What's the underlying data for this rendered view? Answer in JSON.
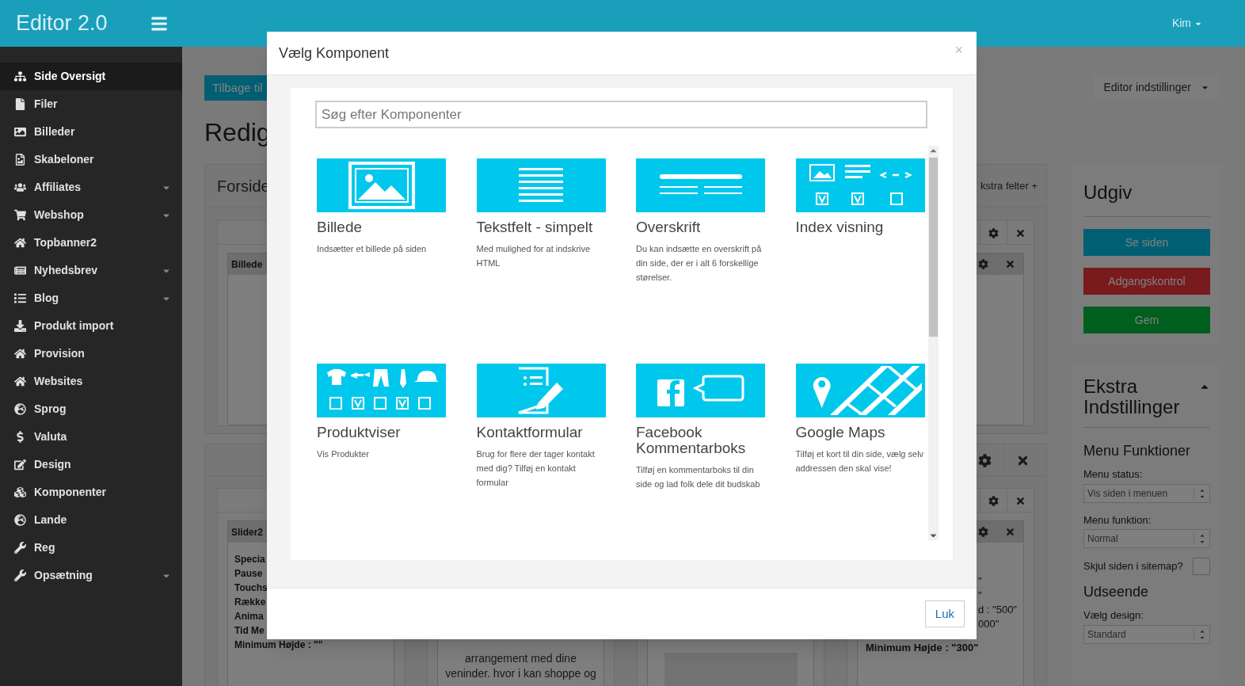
{
  "top_bar": {
    "title": "Editor 2.0",
    "user": "Kim"
  },
  "sidebar": {
    "items": [
      {
        "label": "Side Oversigt",
        "selected": true,
        "has_submenu": false
      },
      {
        "label": "Filer",
        "selected": false,
        "has_submenu": false
      },
      {
        "label": "Billeder",
        "selected": false,
        "has_submenu": false
      },
      {
        "label": "Skabeloner",
        "selected": false,
        "has_submenu": false
      },
      {
        "label": "Affiliates",
        "selected": false,
        "has_submenu": true
      },
      {
        "label": "Webshop",
        "selected": false,
        "has_submenu": true
      },
      {
        "label": "Topbanner2",
        "selected": false,
        "has_submenu": false
      },
      {
        "label": "Nyhedsbrev",
        "selected": false,
        "has_submenu": true
      },
      {
        "label": "Blog",
        "selected": false,
        "has_submenu": true
      },
      {
        "label": "Produkt import",
        "selected": false,
        "has_submenu": false
      },
      {
        "label": "Provision",
        "selected": false,
        "has_submenu": false
      },
      {
        "label": "Websites",
        "selected": false,
        "has_submenu": false
      },
      {
        "label": "Sprog",
        "selected": false,
        "has_submenu": false
      },
      {
        "label": "Valuta",
        "selected": false,
        "has_submenu": false
      },
      {
        "label": "Design",
        "selected": false,
        "has_submenu": false
      },
      {
        "label": "Komponenter",
        "selected": false,
        "has_submenu": false
      },
      {
        "label": "Lande",
        "selected": false,
        "has_submenu": false
      },
      {
        "label": "Reg",
        "selected": false,
        "has_submenu": false
      },
      {
        "label": "Opsætning",
        "selected": false,
        "has_submenu": true
      }
    ]
  },
  "page": {
    "back_button": "Tilbage til",
    "heading": "Redig",
    "settings_button": "Editor indstillinger",
    "top_card": {
      "title": "Forside",
      "extra_link": "kstra felter +",
      "box_title": "Billede"
    },
    "slider_card": {
      "box_title": "Slider2",
      "left_settings": [
        "Specia",
        "Pause",
        "Touchs",
        "Række",
        "Anima",
        "Tid Me",
        "Minimum Højde : \"\""
      ],
      "right_settings": [
        "\"",
        "\"",
        "d : \"500\"",
        "000\""
      ],
      "right_footer": "Minimum Højde : \"300\"",
      "text_lines": [
        "arrangement med dine",
        "veninder. hvor i kan shoppe og"
      ]
    }
  },
  "publish_panel": {
    "title": "Udgiv",
    "buttons": [
      {
        "label": "Se siden",
        "kind": "view"
      },
      {
        "label": "Adgangskontrol",
        "kind": "access"
      },
      {
        "label": "Gem",
        "kind": "save"
      }
    ]
  },
  "extra_panel": {
    "title": "Ekstra Indstillinger",
    "expanded": true,
    "menu_heading": "Menu Funktioner",
    "menu_status_label": "Menu status:",
    "menu_status": "Vis siden i menuen",
    "menu_function_label": "Menu funktion:",
    "menu_function": "Normal",
    "sitemap_label": "Skjul siden i sitemap?",
    "sitemap_hidden": false,
    "appearance_heading": "Udseende",
    "design_label": "Vælg design:",
    "design": "Standard"
  },
  "dialog": {
    "title": "Vælg Komponent",
    "close": "×",
    "search": {
      "placeholder": "Søg efter Komponenter"
    },
    "components": [
      {
        "title": "Billede",
        "description": "Indsætter et billede på siden"
      },
      {
        "title": "Tekstfelt - simpelt",
        "description": "Med mulighed for at indskrive HTML"
      },
      {
        "title": "Overskrift",
        "description": "Du kan indsætte en overskrift på din side, der er i alt 6 forskellige størelser."
      },
      {
        "title": "Index visning"
      },
      {
        "title": "Produktviser",
        "description": "Vis Produkter"
      },
      {
        "title": "Kontaktformular",
        "description": "Brug for flere der tager kontakt med dig? Tilføj en kontakt formular"
      },
      {
        "title": "Facebook Kommentarboks",
        "description": "Tilføj en kommentarboks til din side og lad folk dele dit budskab"
      },
      {
        "title": "Google Maps",
        "description": "Tilføj et kort til din side, vælg selv addressen den skal vise!"
      }
    ],
    "close_button": "Luk"
  }
}
